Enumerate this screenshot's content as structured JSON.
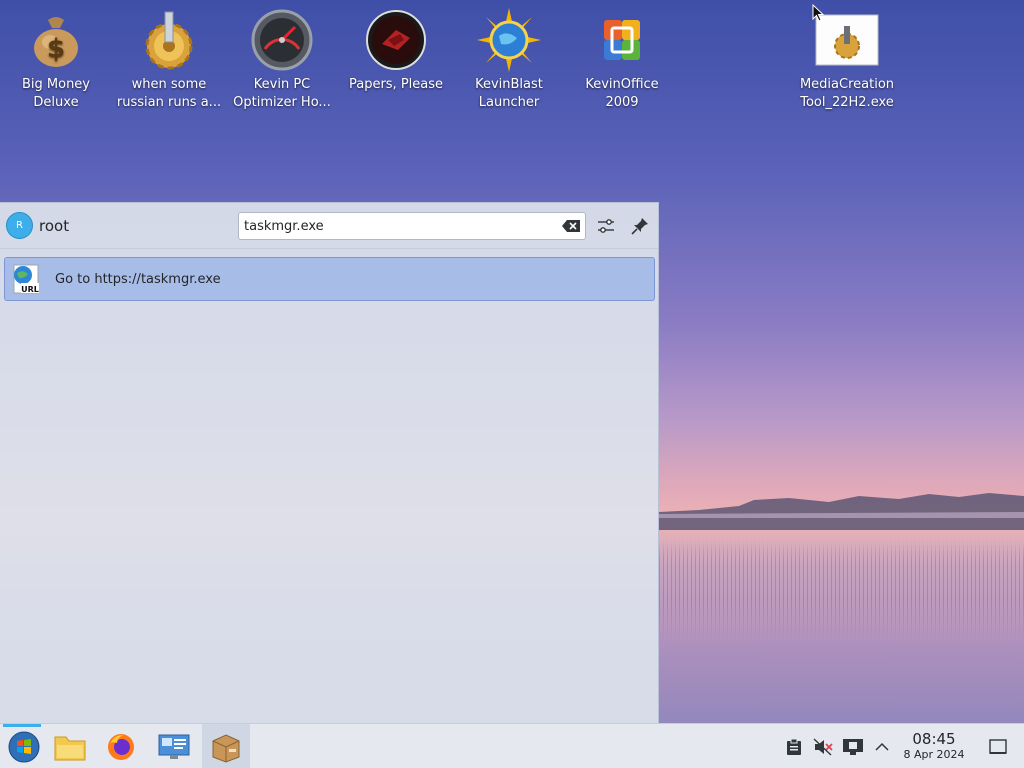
{
  "desktop": {
    "icons": [
      {
        "line1": "Big Money",
        "line2": "Deluxe"
      },
      {
        "line1": "when some",
        "line2": "russian runs a..."
      },
      {
        "line1": "Kevin PC",
        "line2": "Optimizer Ho..."
      },
      {
        "line1": "Papers, Please",
        "line2": ""
      },
      {
        "line1": "KevinBlast",
        "line2": "Launcher"
      },
      {
        "line1": "KevinOffice",
        "line2": "2009"
      },
      {
        "line1": "MediaCreation",
        "line2": "Tool_22H2.exe"
      }
    ]
  },
  "launcher": {
    "user_initial": "R",
    "username": "root",
    "search_value": "taskmgr.exe",
    "result_label": "Go to https://taskmgr.exe",
    "result_icon_text": "URL"
  },
  "taskbar": {
    "time": "08:45",
    "date": "8 Apr 2024"
  },
  "colors": {
    "accent": "#3daee9",
    "result_bg": "#a8bce8"
  }
}
